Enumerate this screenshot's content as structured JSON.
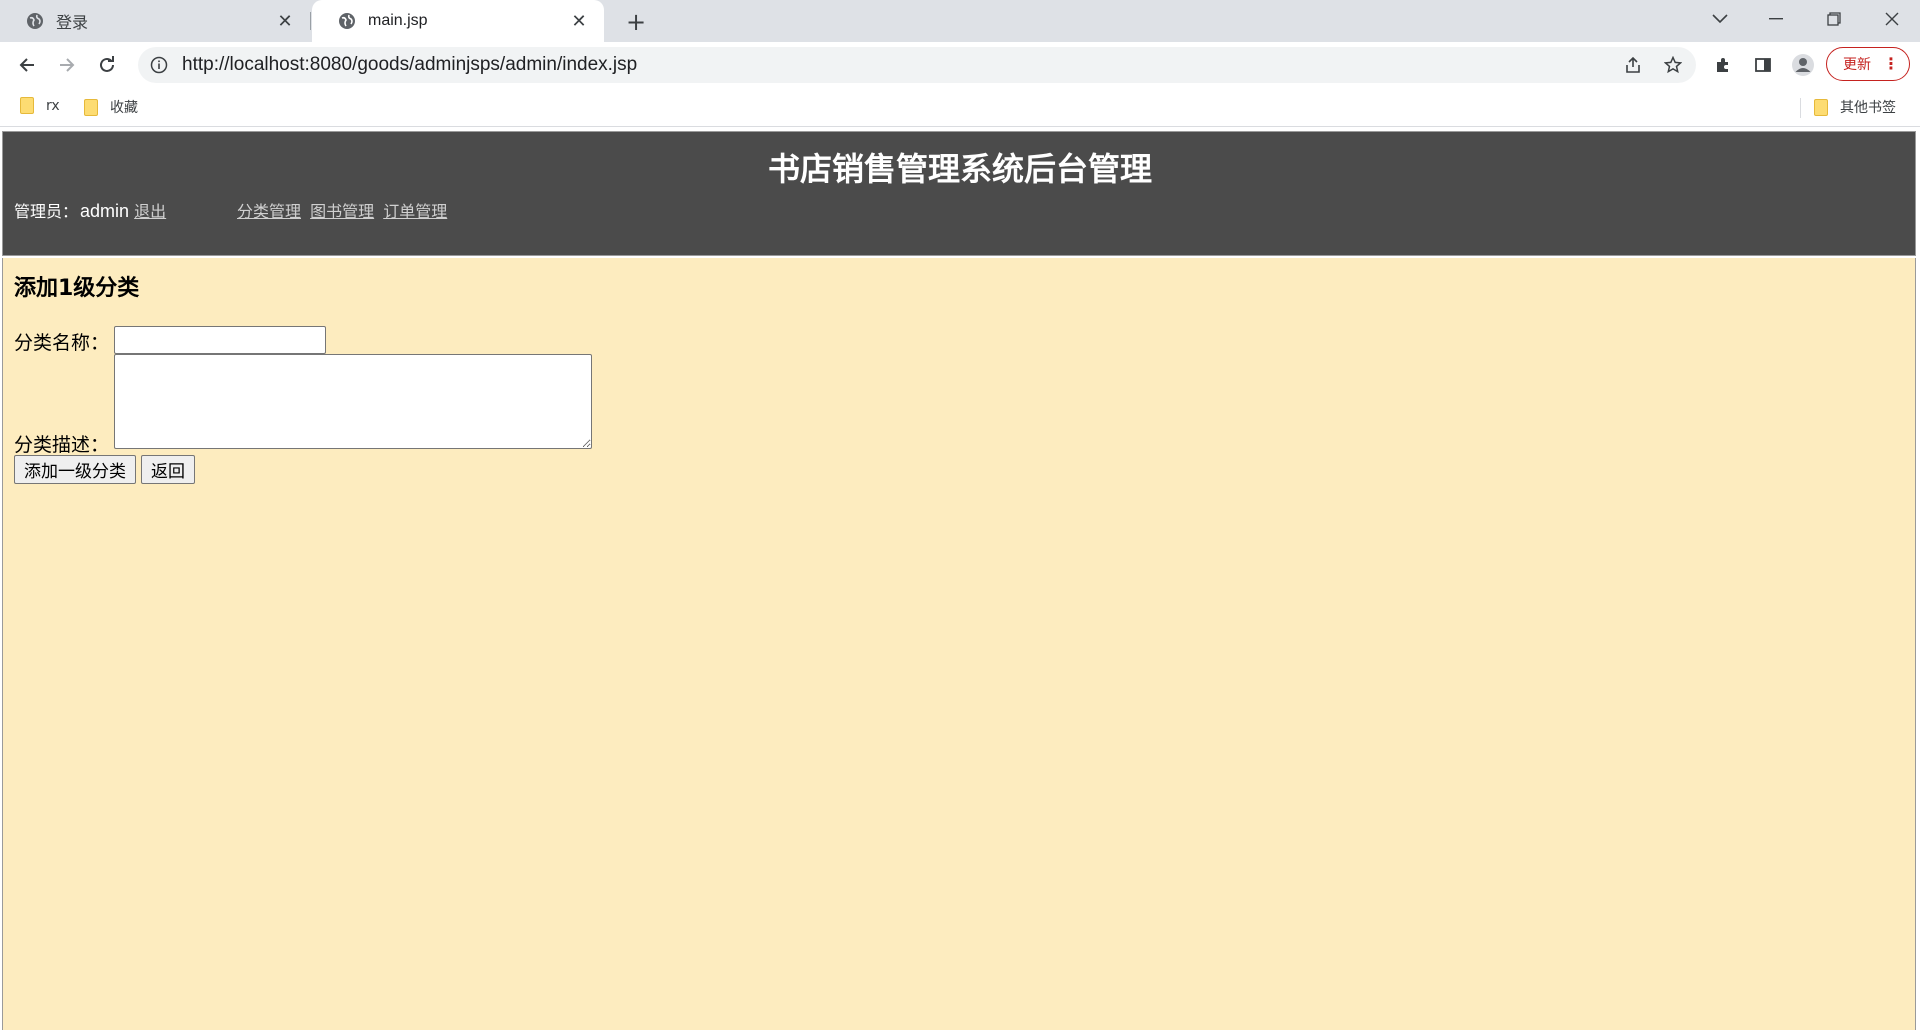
{
  "browser": {
    "tabs": [
      {
        "title": "登录",
        "active": false
      },
      {
        "title": "main.jsp",
        "active": true
      }
    ],
    "url": "http://localhost:8080/goods/adminjsps/admin/index.jsp",
    "update_label": "更新",
    "bookmarks": [
      "rx",
      "收藏"
    ],
    "other_bookmarks": "其他书签"
  },
  "header": {
    "title": "书店销售管理系统后台管理",
    "admin_prefix": "管理员：",
    "admin_name": "admin",
    "logout": "退出",
    "nav": [
      "分类管理",
      "图书管理",
      "订单管理"
    ]
  },
  "form": {
    "heading": "添加1级分类",
    "name_label": "分类名称：",
    "name_value": "",
    "desc_label": "分类描述：",
    "desc_value": "",
    "submit_label": "添加一级分类",
    "back_label": "返回"
  },
  "colors": {
    "header_bg": "#4b4b4b",
    "content_bg": "#fdecbf"
  }
}
